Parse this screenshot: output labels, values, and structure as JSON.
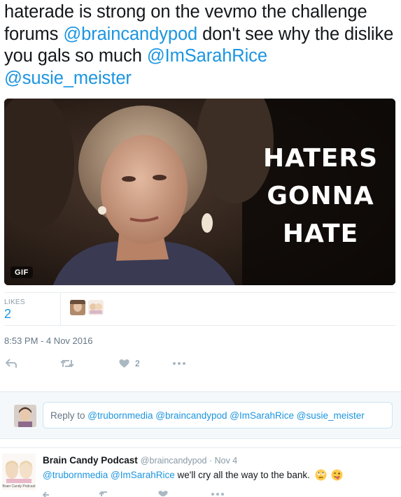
{
  "tweet": {
    "text_plain_1": "haterade is strong on the vevmo the challenge forums ",
    "mention_1": "@braincandypod",
    "text_plain_2": " don't see why the dislike you gals so much ",
    "mention_2": "@ImSarahRice",
    "mention_3": "@susie_meister"
  },
  "media": {
    "caption_line1": "HATERS",
    "caption_line2": "GONNA",
    "caption_line3": "HATE",
    "badge": "GIF"
  },
  "stats": {
    "likes_label": "LIKES",
    "likes_count": "2"
  },
  "timestamp": "8:53 PM - 4 Nov 2016",
  "actions": {
    "like_count": "2",
    "icons": [
      "reply-icon",
      "retweet-icon",
      "heart-icon",
      "more-icon"
    ]
  },
  "reply_box": {
    "prefix": "Reply to ",
    "mentions": "@trubornmedia @braincandypod @ImSarahRice @susie_meister"
  },
  "reply_tweet": {
    "name": "Brain Candy Podcast",
    "handle_time": "@braincandypod · Nov 4",
    "mention_1": "@trubornmedia",
    "mention_2": "@ImSarahRice",
    "text": " we'll cry all the way to the bank.",
    "avatar_caption": "Brain Candy Podcast"
  },
  "colors": {
    "link": "#1b95e0",
    "text": "#14171a",
    "muted": "#657786",
    "border": "#e6ecf0"
  }
}
